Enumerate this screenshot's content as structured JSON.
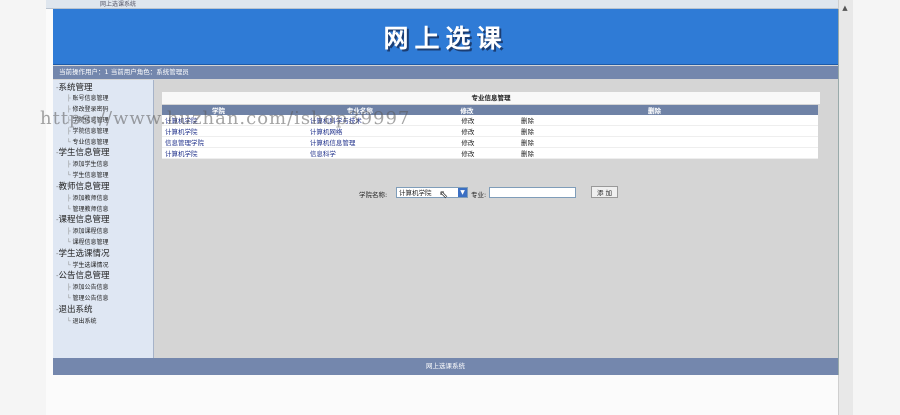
{
  "window": {
    "title": "网上选课系统"
  },
  "banner": {
    "title": "网上选课"
  },
  "status": {
    "text": "当前操作用户：1 当前用户角色：系统管理员"
  },
  "sidebar": {
    "groups": [
      {
        "label": "系统管理",
        "items": [
          "账号信息管理",
          "修改登录密码",
          "学院信息管理",
          "学院信息管理",
          "专业信息管理"
        ]
      },
      {
        "label": "学生信息管理",
        "items": [
          "添加学生信息",
          "学生信息管理"
        ]
      },
      {
        "label": "教师信息管理",
        "items": [
          "添加教师信息",
          "管理教师信息"
        ]
      },
      {
        "label": "课程信息管理",
        "items": [
          "添加课程信息",
          "课程信息管理"
        ]
      },
      {
        "label": "学生选课情况",
        "items": [
          "学生选课情况"
        ]
      },
      {
        "label": "公告信息管理",
        "items": [
          "添加公告信息",
          "管理公告信息"
        ]
      },
      {
        "label": "退出系统",
        "items": [
          "退出系统"
        ]
      }
    ]
  },
  "panel": {
    "title": "专业信息管理"
  },
  "table": {
    "headers": [
      "学院",
      "专业名称",
      "修改",
      "删除"
    ],
    "rows": [
      {
        "college": "计算机学院",
        "major": "计算机科学与技术",
        "edit": "修改",
        "delete": "删除"
      },
      {
        "college": "计算机学院",
        "major": "计算机网络",
        "edit": "修改",
        "delete": "删除"
      },
      {
        "college": "信息管理学院",
        "major": "计算机信息管理",
        "edit": "修改",
        "delete": "删除"
      },
      {
        "college": "计算机学院",
        "major": "信息科学",
        "edit": "修改",
        "delete": "删除"
      }
    ]
  },
  "form": {
    "college_label": "学院名称:",
    "college_value": "计算机学院",
    "major_label": "专业:",
    "major_value": "",
    "add_label": "添 加"
  },
  "footer": {
    "text": "网上选课系统"
  },
  "watermark": {
    "text": "https://www.huzhan.com/ishop39997"
  },
  "colors": {
    "banner": "#2f7bd6",
    "bar": "#7487ad",
    "sidebar": "#dfe7f3"
  }
}
